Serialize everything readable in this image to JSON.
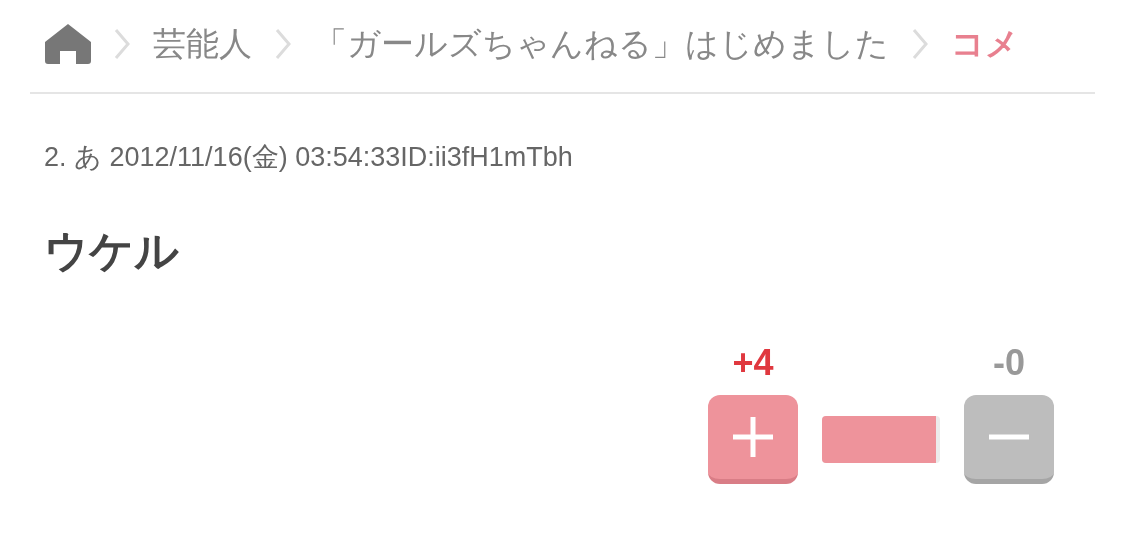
{
  "breadcrumb": [
    {
      "kind": "home"
    },
    {
      "kind": "link",
      "label": "芸能人"
    },
    {
      "kind": "link",
      "label": "「ガールズちゃんねる」はじめました"
    },
    {
      "kind": "current",
      "label": "コメ"
    }
  ],
  "comment": {
    "meta": "2. あ 2012/11/16(金) 03:54:33ID:ii3fH1mTbh",
    "body": "ウケル"
  },
  "votes": {
    "plus_count": "+4",
    "minus_count": "-0",
    "level": 0.97
  }
}
